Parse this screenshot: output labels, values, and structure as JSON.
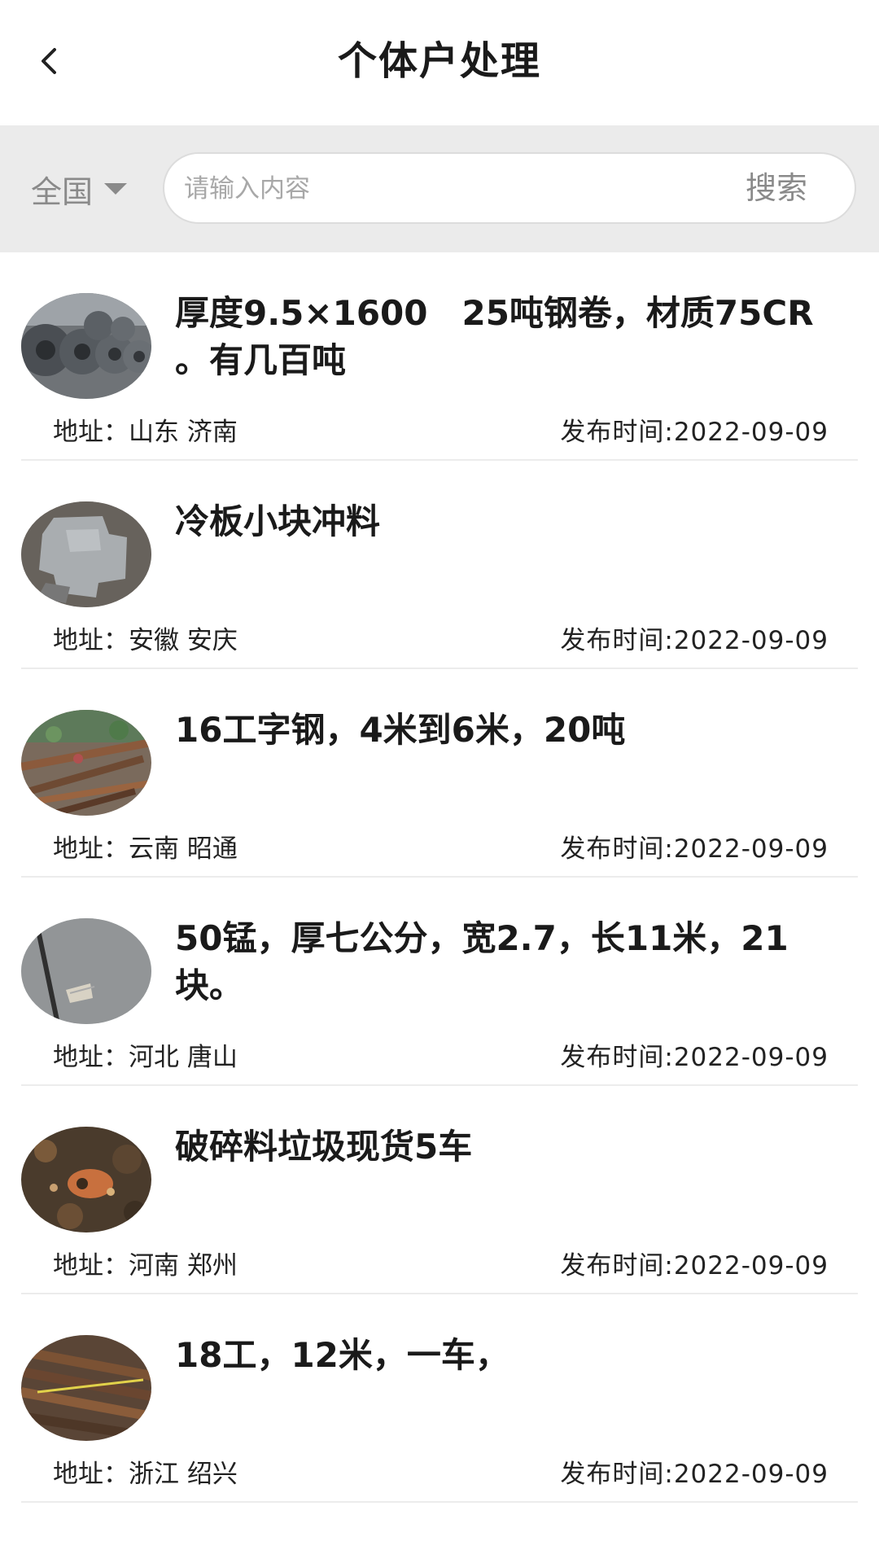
{
  "header": {
    "title": "个体户处理",
    "back_icon": "chevron-left-icon"
  },
  "search": {
    "region": "全国",
    "placeholder": "请输入内容",
    "value": "",
    "button_label": "搜索"
  },
  "items": [
    {
      "title": "厚度9.5×1600　25吨钢卷，材质75CR　。有几百吨",
      "address": "地址：山东  济南",
      "date": "发布时间:2022-09-09",
      "thumb": "steel-coils-image"
    },
    {
      "title": "冷板小块冲料",
      "address": "地址：安徽  安庆",
      "date": "发布时间:2022-09-09",
      "thumb": "cold-plate-scrap-image"
    },
    {
      "title": "16工字钢，4米到6米，20吨",
      "address": "地址：云南  昭通",
      "date": "发布时间:2022-09-09",
      "thumb": "i-beam-pile-image"
    },
    {
      "title": "50锰，厚七公分，宽2.7，长11米，21块。",
      "address": "地址：河北  唐山",
      "date": "发布时间:2022-09-09",
      "thumb": "steel-plate-image"
    },
    {
      "title": "破碎料垃圾现货5车",
      "address": "地址：河南  郑州",
      "date": "发布时间:2022-09-09",
      "thumb": "scrap-pile-image"
    },
    {
      "title": "18工，12米，一车，",
      "address": "地址：浙江  绍兴",
      "date": "发布时间:2022-09-09",
      "thumb": "i-beam-stack-image"
    }
  ]
}
